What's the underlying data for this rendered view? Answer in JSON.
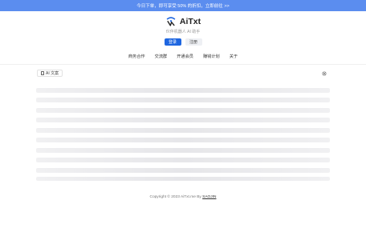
{
  "promo": {
    "text": "今日下单，即可享受 50% 的折扣，立即前往 >>"
  },
  "brand": {
    "name": "AiTxt",
    "tagline": "伙伴机器人 AI 助手"
  },
  "auth": {
    "login_label": "登录",
    "register_label": "注册"
  },
  "nav": {
    "items": [
      {
        "label": "商务合作"
      },
      {
        "label": "交流群"
      },
      {
        "label": "开通会员"
      },
      {
        "label": "赚钱计划"
      },
      {
        "label": "关于"
      }
    ]
  },
  "toolbar": {
    "tab_label": "AI 文案",
    "tab_icon": "document-icon",
    "settings_icon": "gear-icon"
  },
  "footer": {
    "prefix": "Copyright © 2023 AiTxt.me By ",
    "author": "SAOJIN"
  },
  "colors": {
    "promo": "#5b8def",
    "primary": "#1e66e0",
    "skeleton": "#efeff1"
  }
}
